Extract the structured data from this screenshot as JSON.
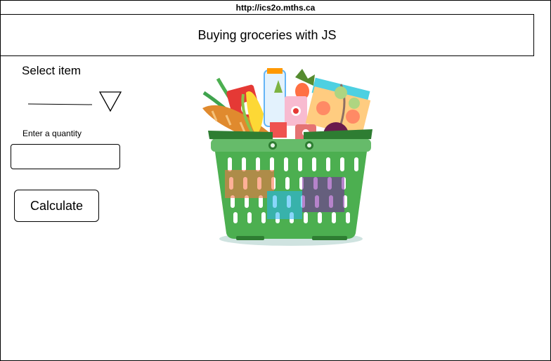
{
  "browser": {
    "url": "http://ics2o.mths.ca"
  },
  "header": {
    "title": "Buying groceries with JS"
  },
  "form": {
    "select_label": "Select item",
    "select_value": "",
    "quantity_label": "Enter a quantity",
    "quantity_value": "",
    "quantity_placeholder": "",
    "calculate_label": "Calculate"
  },
  "image": {
    "icon": "grocery-basket-illustration"
  },
  "colors": {
    "basket_green": "#4caf50",
    "basket_dark": "#2e7d32"
  }
}
